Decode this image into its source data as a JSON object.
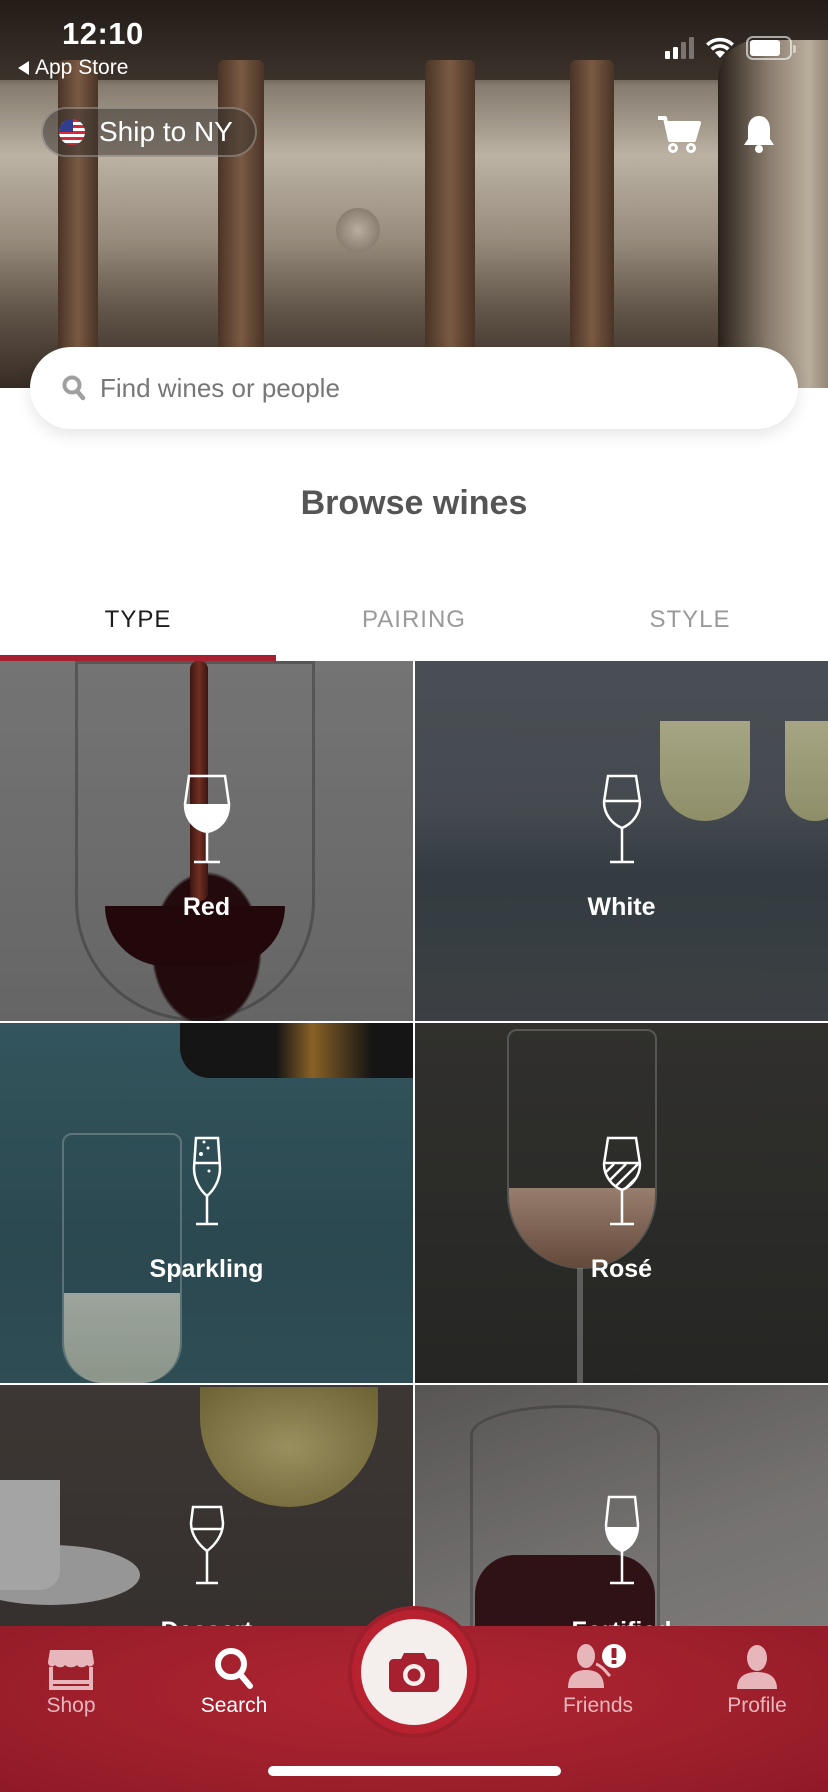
{
  "status_bar": {
    "time": "12:10",
    "back_label": "App Store",
    "signal_bars_active": 2,
    "signal_bars_total": 4,
    "battery_level": 0.8
  },
  "header": {
    "ship_label": "Ship to NY",
    "flag": "us-flag-icon",
    "cart_icon": "cart-icon",
    "bell_icon": "bell-icon"
  },
  "search": {
    "placeholder": "Find wines or people",
    "value": ""
  },
  "browse": {
    "title": "Browse wines"
  },
  "tabs": [
    {
      "label": "TYPE",
      "active": true
    },
    {
      "label": "PAIRING",
      "active": false
    },
    {
      "label": "STYLE",
      "active": false
    }
  ],
  "wine_types": [
    {
      "label": "Red",
      "icon": "red-wine-glass-icon"
    },
    {
      "label": "White",
      "icon": "white-wine-glass-icon"
    },
    {
      "label": "Sparkling",
      "icon": "sparkling-flute-icon"
    },
    {
      "label": "Rosé",
      "icon": "rose-wine-glass-icon"
    },
    {
      "label": "Dessert",
      "icon": "dessert-wine-glass-icon"
    },
    {
      "label": "Fortified",
      "icon": "fortified-wine-glass-icon"
    }
  ],
  "bottom_nav": {
    "items": [
      {
        "label": "Shop",
        "icon": "shop-icon",
        "active": false
      },
      {
        "label": "Search",
        "icon": "search-icon",
        "active": true
      },
      {
        "label": "Friends",
        "icon": "friends-icon",
        "active": false,
        "alert": "!"
      },
      {
        "label": "Profile",
        "icon": "profile-icon",
        "active": false
      }
    ],
    "camera_icon": "camera-icon"
  },
  "colors": {
    "brand": "#a6202f",
    "nav_bg": "#9e1f2c",
    "nav_inactive": "#e7b6bb",
    "camera_bg": "#f4efec"
  }
}
